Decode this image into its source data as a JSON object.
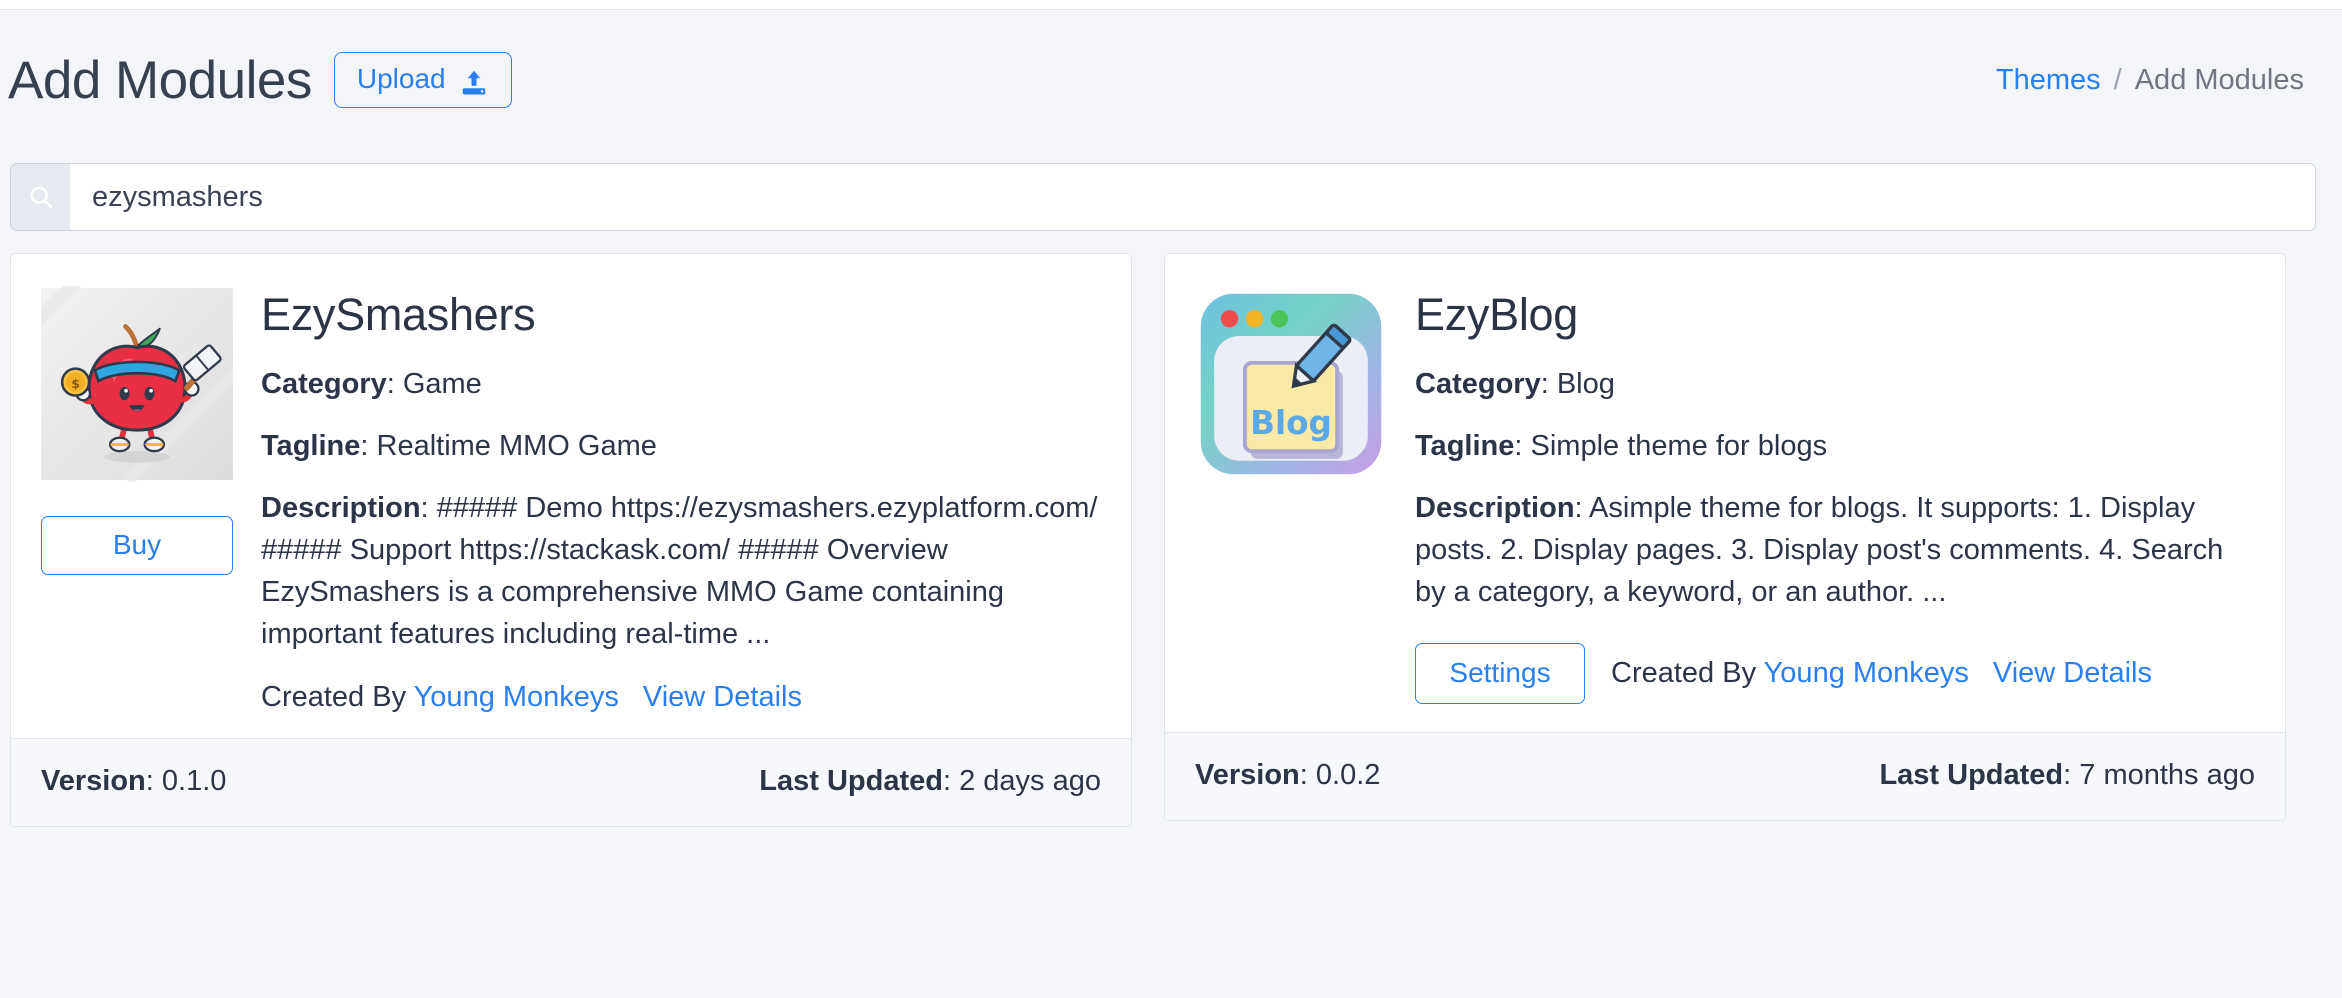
{
  "header": {
    "title": "Add Modules",
    "upload_label": "Upload",
    "upload_icon": "upload-icon",
    "breadcrumb": {
      "parent": "Themes",
      "separator": "/",
      "current": "Add Modules"
    }
  },
  "search": {
    "icon": "search-icon",
    "value": "ezysmashers",
    "placeholder": "Search"
  },
  "labels": {
    "category": "Category",
    "tagline": "Tagline",
    "description": "Description",
    "version": "Version",
    "last_updated": "Last Updated",
    "created_by": "Created By",
    "view_details": "View Details"
  },
  "colors": {
    "accent": "#2a7ff0",
    "page_bg": "#f4f5f9",
    "card_bg": "#ffffff",
    "card_border": "#dfe3ea",
    "footer_bg": "#f7f8fb",
    "text": "#2c3547",
    "muted": "#6f7682"
  },
  "cards": [
    {
      "name": "EzySmashers",
      "icon": "apple-mascot-thumbnail",
      "category": "Game",
      "tagline": "Realtime MMO Game",
      "description": "##### Demo https://ezysmashers.ezyplatform.com/ ##### Support https://stackask.com/ ##### Overview EzySmashers is a comprehensive MMO Game containing important features including real-time ...",
      "action_label": "Buy",
      "author": "Young Monkeys",
      "view_details": "View Details",
      "version": "0.1.0",
      "last_updated": "2 days ago"
    },
    {
      "name": "EzyBlog",
      "icon": "blog-window-thumbnail",
      "category": "Blog",
      "tagline": "Simple theme for blogs",
      "description": "Asimple theme for blogs. It supports: 1. Display posts. 2. Display pages. 3. Display post's comments. 4. Search by a category, a keyword, or an author. ...",
      "action_label": "Settings",
      "author": "Young Monkeys",
      "view_details": "View Details",
      "version": "0.0.2",
      "last_updated": "7 months ago"
    }
  ]
}
